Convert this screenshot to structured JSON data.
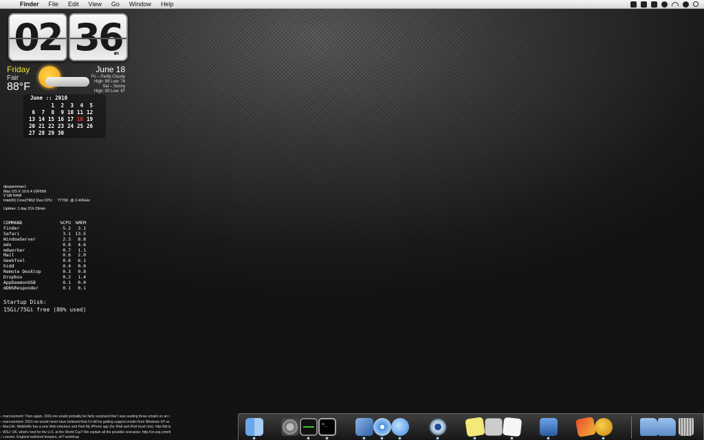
{
  "menubar": {
    "app_name": "Finder",
    "items": [
      "File",
      "Edit",
      "View",
      "Go",
      "Window",
      "Help"
    ]
  },
  "clock": {
    "hours": "02",
    "minutes": "36",
    "ampm": "PM"
  },
  "weather": {
    "day": "Friday",
    "condition": "Fair",
    "temperature": "88°F",
    "date": "June 18",
    "forecast_line1": "Fri – Partly Cloudy",
    "forecast_line2": "High: 89 Low: 74",
    "forecast_line3": "Sat – Sunny",
    "forecast_line4": "High: 93 Low: 67"
  },
  "calendar": {
    "title": "June :: 2010",
    "today": "18",
    "days": [
      "",
      "",
      "1",
      "2",
      "3",
      "4",
      "5",
      "6",
      "7",
      "8",
      "9",
      "10",
      "11",
      "12",
      "13",
      "14",
      "15",
      "16",
      "17",
      "18",
      "19",
      "20",
      "21",
      "22",
      "23",
      "24",
      "25",
      "26",
      "27",
      "28",
      "29",
      "30",
      "",
      "",
      ""
    ]
  },
  "sysinfo": {
    "hostname": "dpsparemac1",
    "os": "Mac OS X 10.6.4 10F569",
    "ram": "2 GB RAM",
    "cpu": "Intel(R) Core(TM)2 Duo CPU     T7700  @ 2.40GHz",
    "uptime": "Uptime: 1 day 21h 29min"
  },
  "processes": {
    "headers": [
      "COMMAND",
      "%CPU",
      "%MEM"
    ],
    "rows": [
      [
        "Finder",
        "5.2",
        "3.1"
      ],
      [
        "Safari",
        "3.1",
        "13.5"
      ],
      [
        "WindowServer",
        "2.3",
        "8.8"
      ],
      [
        "mds",
        "0.8",
        "4.6"
      ],
      [
        "mdworker",
        "0.7",
        "1.1"
      ],
      [
        "Mail",
        "0.6",
        "2.0"
      ],
      [
        "GeekTool",
        "0.6",
        "6.1"
      ],
      [
        "hidd",
        "0.4",
        "0.0"
      ],
      [
        "Remote Desktop",
        "0.3",
        "0.8"
      ],
      [
        "Dropbox",
        "0.2",
        "1.4"
      ],
      [
        "AppDaemonUSB",
        "0.1",
        "0.0"
      ],
      [
        "mDNSResponder",
        "0.1",
        "0.1"
      ]
    ]
  },
  "disk": {
    "label": "Startup Disk:",
    "value": "15Gi/75Gi free (80% used)"
  },
  "feed": [
    "– marcoarment: Then again, 2001-me would probably be fairly surprised that I was reading those emails on an i",
    "– marcoarment: 2001-me would never have believed that I'd still be getting support emails from Windows XP us",
    "– MacLife: MobileMe has a new Web interface and Find My iPhone app (for iPad and iPod touch too). http://bit.ly",
    "– WSJ: OK, what's next for the U.S. at the World Cup? We explain all the possible scenarios: http://on.wsj.com/b",
    "– Lessien: England switched keepers, eh? worldcup"
  ],
  "dock": {
    "items": [
      "Finder",
      "System Preferences",
      "Activity Monitor",
      "Terminal",
      "Mail",
      "Safari",
      "iChat",
      "iTunes",
      "Stickies",
      "Calculator",
      "TextEdit",
      "Preview",
      "MegaZeux",
      "Script Editor",
      "Applications",
      "Documents",
      "Trash"
    ]
  }
}
